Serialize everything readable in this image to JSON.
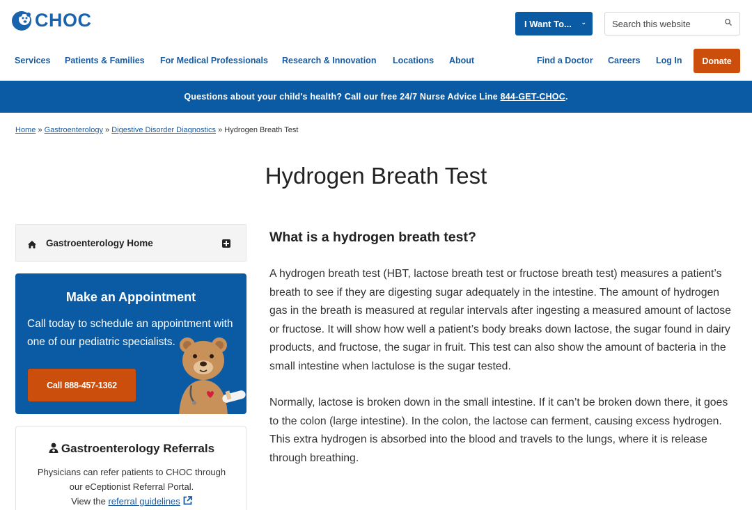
{
  "header": {
    "logo_text": "CHOC",
    "i_want_label": "I Want To...",
    "search_placeholder": "Search this website",
    "nav_left": [
      "Services",
      "Patients & Families",
      "For Medical Professionals",
      "Research & Innovation",
      "Locations",
      "About"
    ],
    "nav_right": [
      "Find a Doctor",
      "Careers",
      "Log In"
    ],
    "donate_label": "Donate"
  },
  "banner": {
    "text": "Questions about your child's health? Call our free 24/7 Nurse Advice Line ",
    "phone_link": "844-GET-CHOC",
    "suffix": "."
  },
  "breadcrumb": {
    "items": [
      "Home",
      "Gastroenterology",
      "Digestive Disorder Diagnostics"
    ],
    "separator": "»",
    "current": "Hydrogen Breath Test"
  },
  "page_title": "Hydrogen Breath Test",
  "sidebar": {
    "home_label": "Gastroenterology Home",
    "appointment": {
      "title": "Make an Appointment",
      "text": "Call today to schedule an appointment with one of our pediatric specialists.",
      "call_button": "Call 888-457-1362"
    },
    "referrals": {
      "title": "Gastroenterology Referrals",
      "line1": "Physicians can refer patients to CHOC through",
      "line2": "our eCeptionist Referral Portal.",
      "line3_prefix": "View the ",
      "line3_link": "referral guidelines"
    }
  },
  "main": {
    "heading": "What is a hydrogen breath test?",
    "paragraphs": [
      "A hydrogen breath test (HBT, lactose breath test or fructose breath test) measures a patient’s breath to see if they are digesting sugar adequately in the intestine. The amount of hydrogen gas in the breath is measured at regular intervals after ingesting a measured amount of lactose or fructose. It will show how well a patient’s body breaks down lactose, the sugar found in dairy products, and fructose, the sugar in fruit. This test can also show the amount of bacteria in the small intestine when lactulose is the sugar tested.",
      "Normally, lactose is broken down in the small intestine. If it can’t be broken down there, it goes to the colon (large intestine). In the colon, the lactose can ferment, causing excess hydrogen.  This extra hydrogen is absorbed into the blood and travels to the lungs, where it is release through breathing."
    ]
  },
  "colors": {
    "brand_blue": "#0a5aa4",
    "link_blue": "#1a5a9e",
    "accent_orange": "#cc4e0c"
  },
  "icons": [
    "choc-logo-icon",
    "chevron-down-icon",
    "search-icon",
    "home-icon",
    "expand-plus-icon",
    "bear-mascot-icon",
    "doctor-referral-icon",
    "external-link-icon"
  ]
}
